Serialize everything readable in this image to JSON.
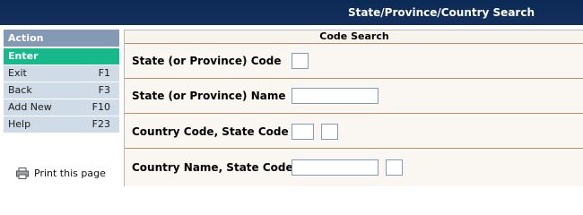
{
  "header": {
    "title": "State/Province/Country Search"
  },
  "sidebar": {
    "title": "Action",
    "items": [
      {
        "label": "Enter",
        "key": ""
      },
      {
        "label": "Exit",
        "key": "F1"
      },
      {
        "label": "Back",
        "key": "F3"
      },
      {
        "label": "Add New",
        "key": "F10"
      },
      {
        "label": "Help",
        "key": "F23"
      }
    ],
    "print_label": "Print this page"
  },
  "main": {
    "heading": "Code Search",
    "fields": [
      {
        "label": "State (or Province) Code",
        "value": ""
      },
      {
        "label": "State (or Province) Name",
        "value": ""
      },
      {
        "label": "Country Code, State Code",
        "value1": "",
        "value2": ""
      },
      {
        "label": "Country Name, State Code",
        "value1": "",
        "value2": ""
      }
    ]
  }
}
